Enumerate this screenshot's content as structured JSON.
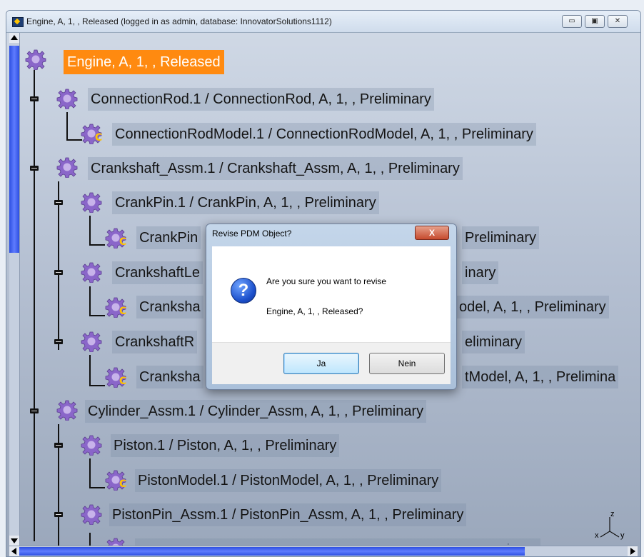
{
  "window": {
    "title": "Engine, A, 1, , Released (logged in as admin, database: InnovatorSolutions1112)",
    "minimize": "▭",
    "maximize": "▣",
    "close": "✕"
  },
  "tree": {
    "root": "Engine, A, 1, , Released",
    "connection_rod": "ConnectionRod.1 / ConnectionRod, A, 1, , Preliminary",
    "connection_rod_model": "ConnectionRodModel.1 / ConnectionRodModel, A, 1, , Preliminary",
    "crankshaft_assm": "Crankshaft_Assm.1 / Crankshaft_Assm, A, 1, , Preliminary",
    "crank_pin": "CrankPin.1 / CrankPin, A, 1, , Preliminary",
    "crank_pin_model_visible": "CrankPin",
    "crank_pin_model_right": "Preliminary",
    "crankshaft_left_visible": "CrankshaftLe",
    "crankshaft_left_right": "inary",
    "crankshaft_left_model_visible": "Cranksha",
    "crankshaft_left_model_right": "odel, A, 1, , Preliminary",
    "crankshaft_right_visible": "CrankshaftR",
    "crankshaft_right_right": "eliminary",
    "crankshaft_right_model_visible": "Cranksha",
    "crankshaft_right_model_right": "tModel, A, 1, , Prelimina",
    "cylinder_assm": "Cylinder_Assm.1 / Cylinder_Assm, A, 1, , Preliminary",
    "piston": "Piston.1 / Piston, A, 1, , Preliminary",
    "piston_model": "PistonModel.1 / PistonModel, A, 1, , Preliminary",
    "piston_pin_assm": "PistonPin_Assm.1 / PistonPin_Assm, A, 1, , Preliminary",
    "partial_bottom": "inary"
  },
  "axis": {
    "z": "z",
    "x": "x",
    "y": "y"
  },
  "dialog": {
    "title": "Revise PDM Object?",
    "close": "X",
    "message_line1": "Are you sure you want to revise",
    "message_line2": "Engine, A, 1, , Released?",
    "yes": "Ja",
    "no": "Nein"
  },
  "icons": {
    "gear": "gear-icon",
    "component_badge": "C",
    "question": "?"
  },
  "colors": {
    "root_highlight": "#ff8a10",
    "gear": "#8a66c9",
    "badge": "#ffc400",
    "scroll_thumb": "#2d4fe0"
  }
}
